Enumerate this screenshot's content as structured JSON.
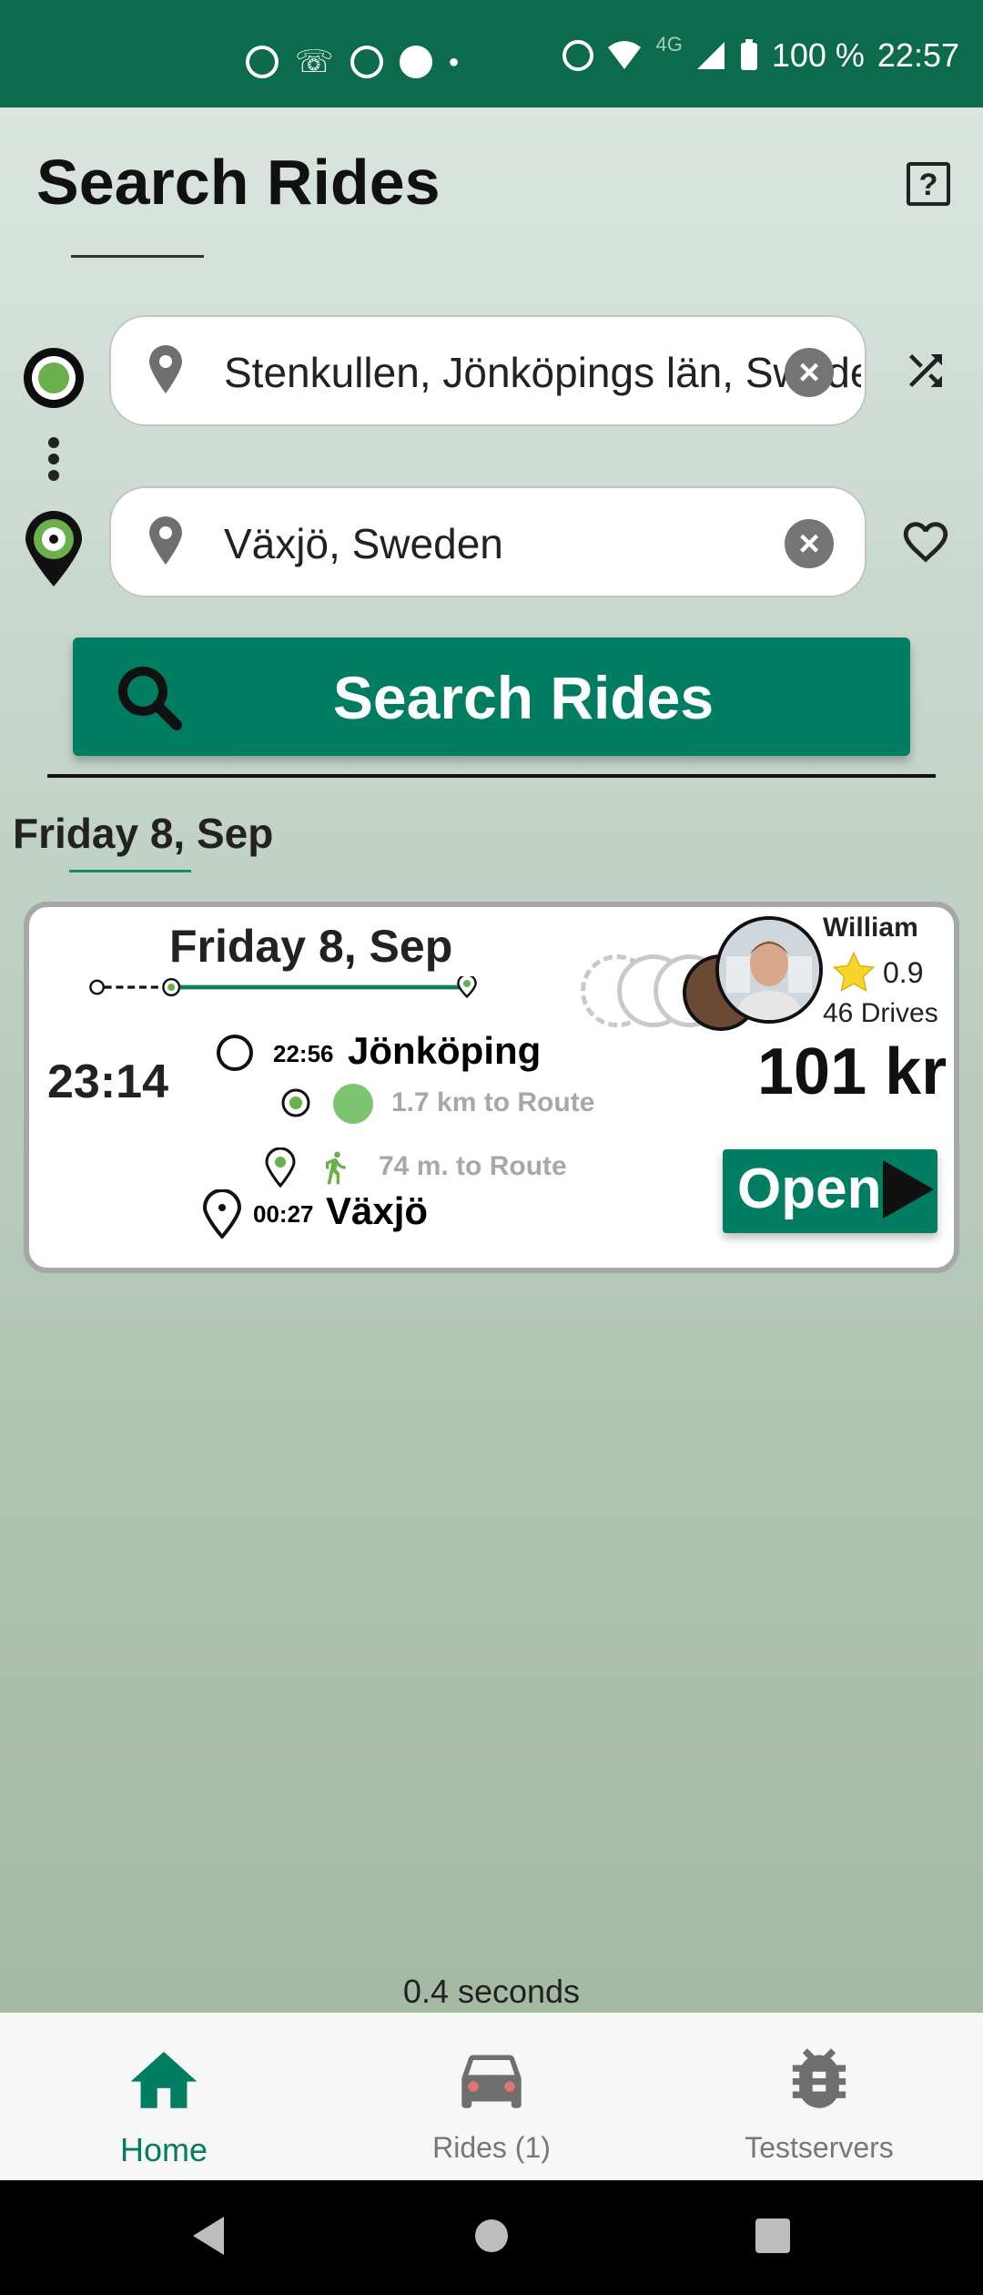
{
  "status_bar": {
    "network": "4G",
    "battery": "100 %",
    "time": "22:57"
  },
  "header": {
    "title": "Search Rides",
    "help_icon": "help-icon"
  },
  "route": {
    "from_value": "Stenkullen, Jönköpings län, Sweden",
    "to_value": "Växjö, Sweden"
  },
  "search_button": {
    "label": "Search Rides"
  },
  "results": {
    "date_heading": "Friday 8, Sep"
  },
  "ride": {
    "date": "Friday 8, Sep",
    "departure_time": "23:14",
    "pickup_time": "22:56",
    "pickup_city": "Jönköping",
    "pickup_distance": "1.7 km to Route",
    "dropoff_distance": "74 m. to Route",
    "dropoff_time": "00:27",
    "dropoff_city": "Växjö",
    "price": "101 kr",
    "driver_name": "William",
    "rating": "0.9",
    "drives": "46 Drives",
    "open_label": "Open",
    "seats_taken": 1,
    "seats_free": 3
  },
  "timing": "0.4 seconds",
  "bottom_nav": {
    "home": "Home",
    "rides": "Rides (1)",
    "testservers": "Testservers"
  },
  "colors": {
    "brand": "#017d62",
    "status_bar": "#0b6b4c",
    "accent_green": "#6ab04c"
  }
}
